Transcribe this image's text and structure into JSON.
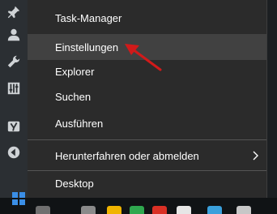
{
  "menu": {
    "items": [
      {
        "label": "Task-Manager"
      },
      {
        "label": "Einstellungen"
      },
      {
        "label": "Explorer"
      },
      {
        "label": "Suchen"
      },
      {
        "label": "Ausführen"
      },
      {
        "label": "Herunterfahren oder abmelden"
      },
      {
        "label": "Desktop"
      }
    ],
    "hovered_item": "Einstellungen"
  },
  "left_bar_icons": [
    "pin-icon",
    "user-icon",
    "wrench-icon",
    "sliders-icon",
    "yoast-icon",
    "back-circle-icon"
  ],
  "colors": {
    "menu_background": "#2b2b2b",
    "hover_background": "#414141",
    "text": "#ffffff",
    "annotation_arrow": "#d11a1a"
  }
}
